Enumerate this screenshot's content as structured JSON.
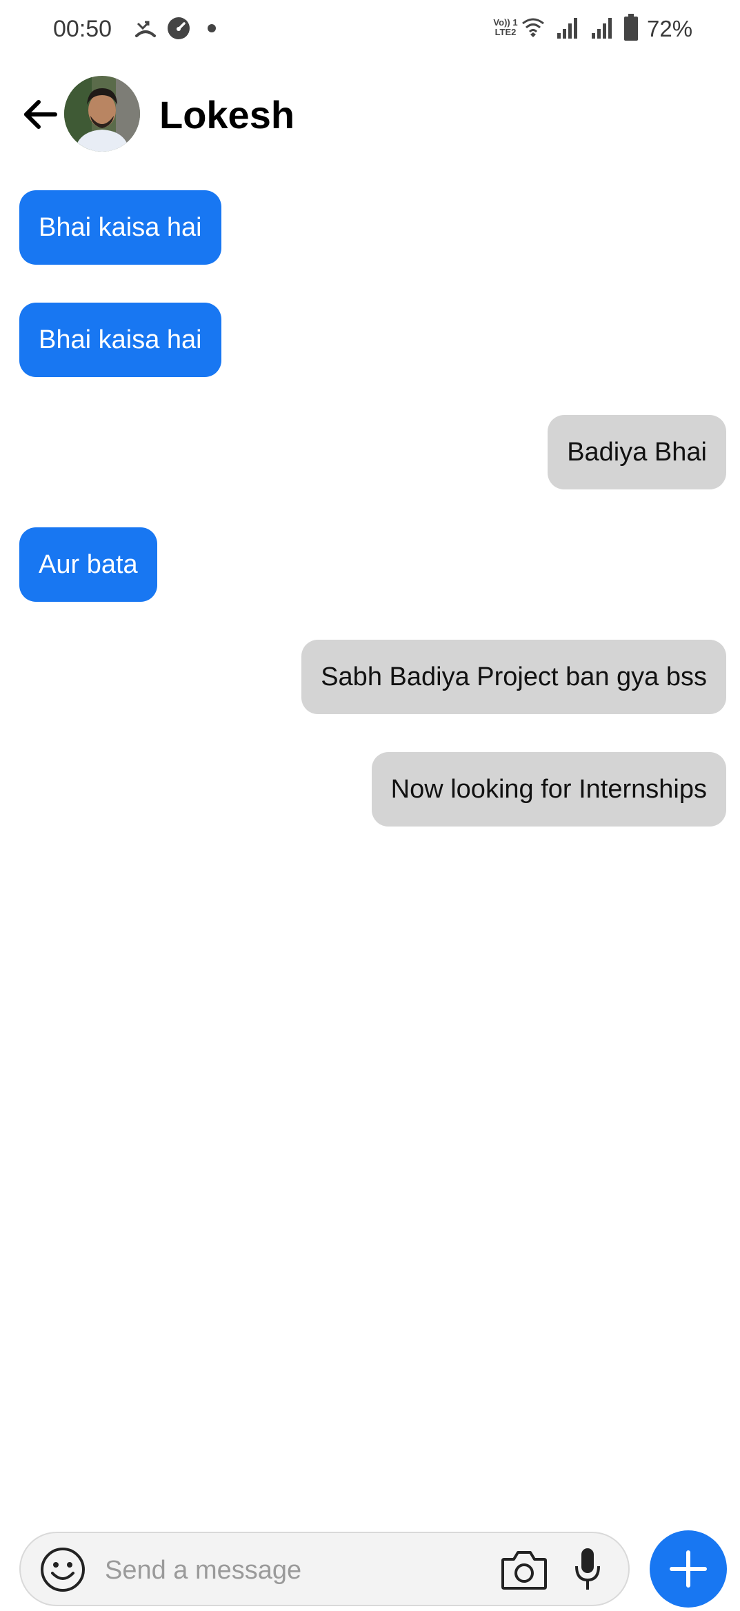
{
  "status_bar": {
    "time": "00:50",
    "battery_percent": "72%",
    "icons": [
      "missed-call-icon",
      "speedometer-icon",
      "notification-dot-icon",
      "volte-icon",
      "wifi-icon",
      "signal-icon",
      "signal-icon",
      "battery-icon"
    ],
    "volte_label": "Vo)) 1\nLTE2"
  },
  "header": {
    "contact_name": "Lokesh",
    "back_icon": "arrow-left-icon",
    "avatar_icon": "contact-avatar"
  },
  "messages": [
    {
      "direction": "incoming",
      "text": "Bhai kaisa hai"
    },
    {
      "direction": "incoming",
      "text": "Bhai kaisa hai"
    },
    {
      "direction": "outgoing",
      "text": "Badiya Bhai"
    },
    {
      "direction": "incoming",
      "text": "Aur bata"
    },
    {
      "direction": "outgoing",
      "text": "Sabh Badiya Project ban gya bss"
    },
    {
      "direction": "outgoing",
      "text": "Now looking for Internships"
    }
  ],
  "composer": {
    "placeholder": "Send a message",
    "value": "",
    "icons": [
      "emoji-icon",
      "camera-icon",
      "mic-icon",
      "plus-icon"
    ]
  },
  "colors": {
    "incoming_bubble": "#1877f2",
    "outgoing_bubble": "#d4d4d4",
    "accent": "#1877f2"
  }
}
